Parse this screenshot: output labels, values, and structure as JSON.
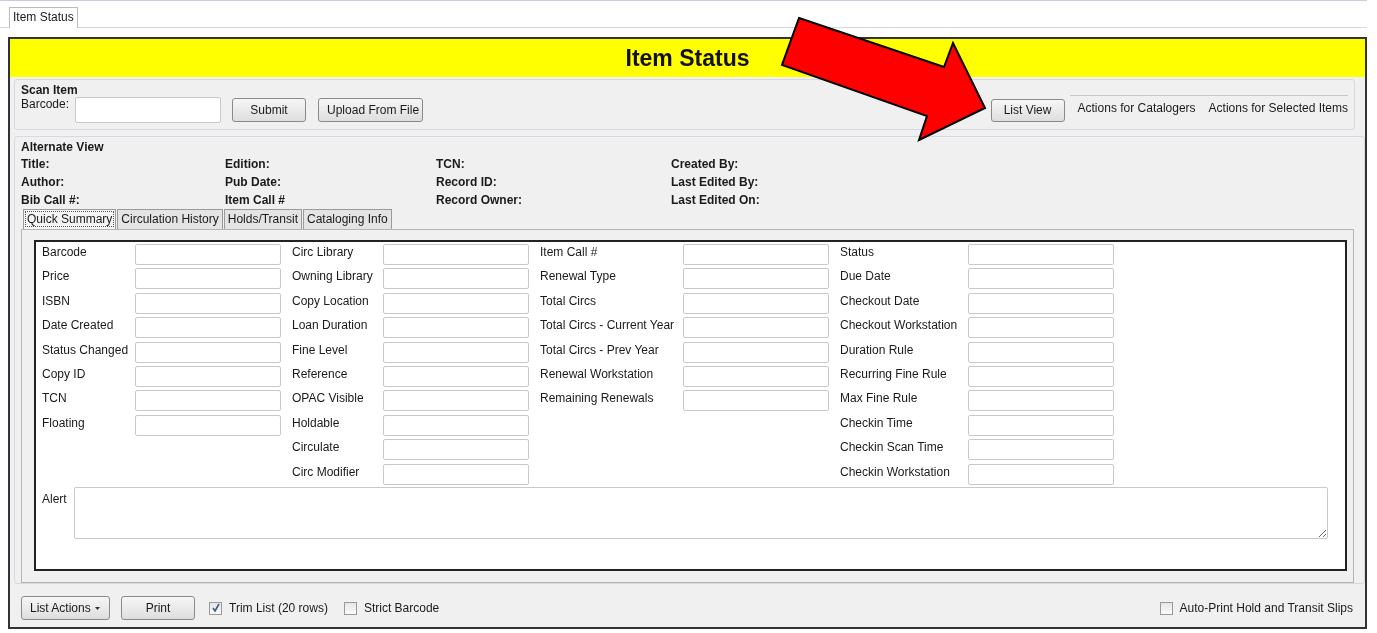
{
  "window_tabs": [
    {
      "label": "Item Status",
      "selected": true
    }
  ],
  "header": {
    "title": "Item Status"
  },
  "scan_item": {
    "legend": "Scan Item",
    "barcode_label": "Barcode:",
    "buttons": [
      "Submit",
      "Upload From File"
    ]
  },
  "view_button": "List View",
  "menus": [
    "Actions for Catalogers",
    "Actions for Selected Items"
  ],
  "alternate_view": {
    "legend": "Alternate View",
    "columns": [
      {
        "labels": [
          "Title:",
          "Author:",
          "Bib Call #:"
        ]
      },
      {
        "labels": [
          "Edition:",
          "Pub Date:",
          "Item Call #"
        ]
      },
      {
        "labels": [
          "TCN:",
          "Record ID:",
          "Record Owner:"
        ]
      },
      {
        "labels": [
          "Created By:",
          "Last Edited By:",
          "Last Edited On:"
        ]
      }
    ]
  },
  "detail_tabs": [
    {
      "label": "Quick Summary",
      "selected": true
    },
    {
      "label": "Circulation History",
      "selected": false
    },
    {
      "label": "Holds/Transit",
      "selected": false
    },
    {
      "label": "Cataloging Info",
      "selected": false
    }
  ],
  "summary": {
    "columns": [
      {
        "labels": [
          "Barcode",
          "Price",
          "ISBN",
          "Date Created",
          "Status Changed",
          "Copy ID",
          "TCN",
          "Floating"
        ]
      },
      {
        "labels": [
          "Circ Library",
          "Owning Library",
          "Copy Location",
          "Loan Duration",
          "Fine Level",
          "Reference",
          "OPAC Visible",
          "Holdable",
          "Circulate",
          "Circ Modifier"
        ]
      },
      {
        "labels": [
          "Item Call #",
          "Renewal Type",
          "Total Circs",
          "Total Circs - Current Year",
          "Total Circs - Prev Year",
          "Renewal Workstation",
          "Remaining Renewals"
        ]
      },
      {
        "labels": [
          "Status",
          "Due Date",
          "Checkout Date",
          "Checkout Workstation",
          "Duration Rule",
          "Recurring Fine Rule",
          "Max Fine Rule",
          "Checkin Time",
          "Checkin Scan Time",
          "Checkin Workstation"
        ]
      }
    ],
    "alert_label": "Alert"
  },
  "footer": {
    "list_actions": "List Actions",
    "print": "Print",
    "options": [
      {
        "label": "Trim List (20 rows)",
        "checked": true
      },
      {
        "label": "Strict Barcode",
        "checked": false
      }
    ],
    "auto_print": {
      "label": "Auto-Print Hold and Transit Slips",
      "checked": false
    }
  }
}
